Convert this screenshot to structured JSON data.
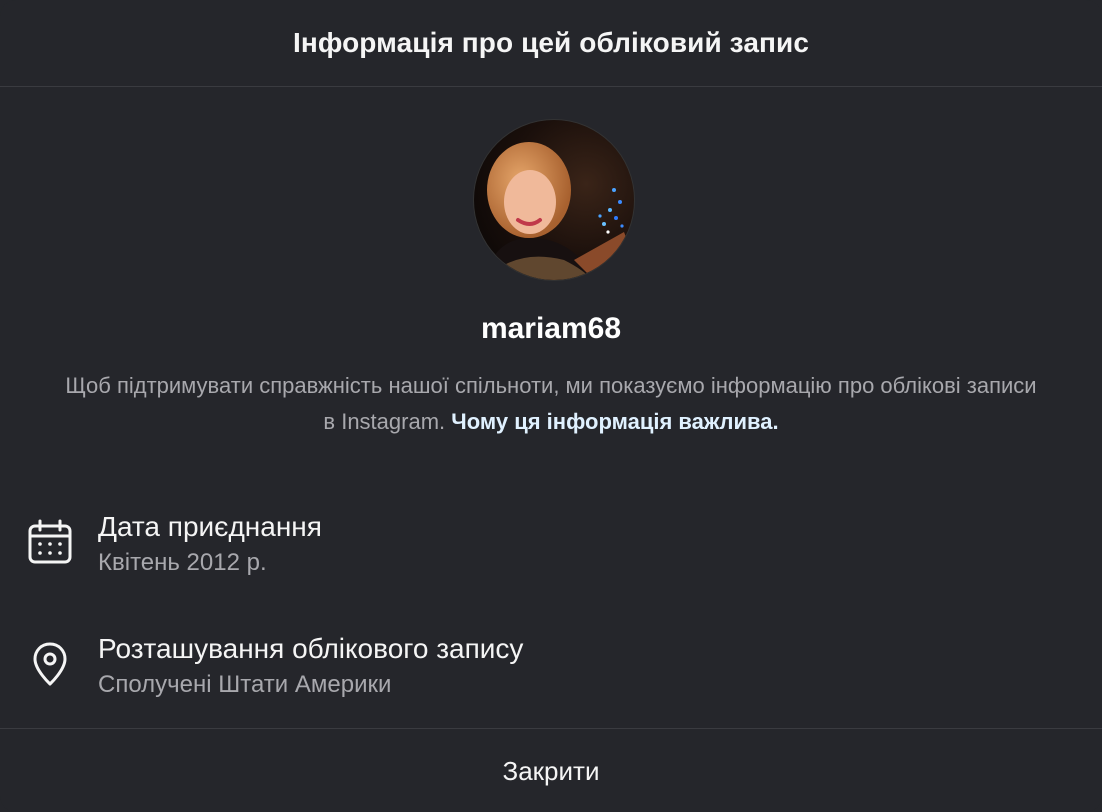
{
  "dialog": {
    "title": "Інформація про цей обліковий запис",
    "username": "mariam68",
    "notice": {
      "text": "Щоб підтримувати справжність нашої спільноти, ми показуємо інформацію про облікові записи в Instagram. ",
      "link": "Чому ця інформація важлива."
    },
    "rows": [
      {
        "icon": "calendar-icon",
        "label": "Дата приєднання",
        "value": "Квітень 2012 р."
      },
      {
        "icon": "location-pin-icon",
        "label": "Розташування облікового запису",
        "value": "Сполучені Штати Америки"
      }
    ],
    "close_label": "Закрити"
  },
  "colors": {
    "background": "#25262b",
    "divider": "#3a3b40",
    "text_primary": "#f5f5f5",
    "text_secondary": "#a8a8ad",
    "link": "#e0f1ff"
  }
}
